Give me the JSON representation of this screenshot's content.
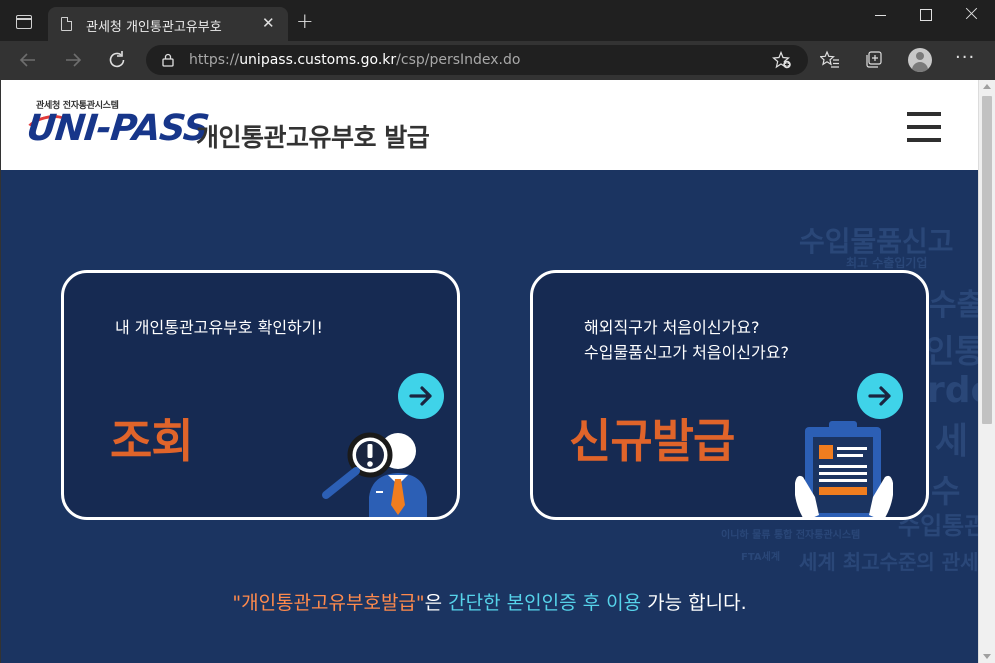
{
  "browser": {
    "tab_title": "관세청 개인통관고유부호",
    "tab_close": "✕",
    "new_tab": "+",
    "url_scheme": "https://",
    "url_host": "unipass.customs.go.kr",
    "url_path": "/csp/persIndex.do",
    "menu": "···"
  },
  "site": {
    "logo_small": "관세청 전자통관시스템",
    "logo_main": "UNI-PASS",
    "title": "개인통관고유부호  발급"
  },
  "background_text": [
    "수입물품신고",
    "최고  수출입기업",
    "수출",
    "인통",
    "rdo",
    "세",
    "수",
    "수입통관",
    "이니하 물류 통합 전자통관시스템",
    "FTA세계",
    "세계 최고수준의 관세"
  ],
  "cards": {
    "lookup": {
      "desc": "내 개인통관고유부호 확인하기!",
      "action": "조회"
    },
    "issue": {
      "desc_line1": "해외직구가 처음이신가요?",
      "desc_line2": "수입물품신고가 처음이신가요?",
      "action": "신규발급"
    }
  },
  "notice": {
    "part1": "\"개인통관고유부호발급\"",
    "part2": "은 ",
    "part3": "간단한 본인인증 후 이용",
    "part4": " 가능 합니다."
  },
  "colors": {
    "page_bg": "#1b3461",
    "card_bg": "#162a52",
    "accent_orange": "#e0642a",
    "accent_cyan": "#3fd3e9"
  }
}
